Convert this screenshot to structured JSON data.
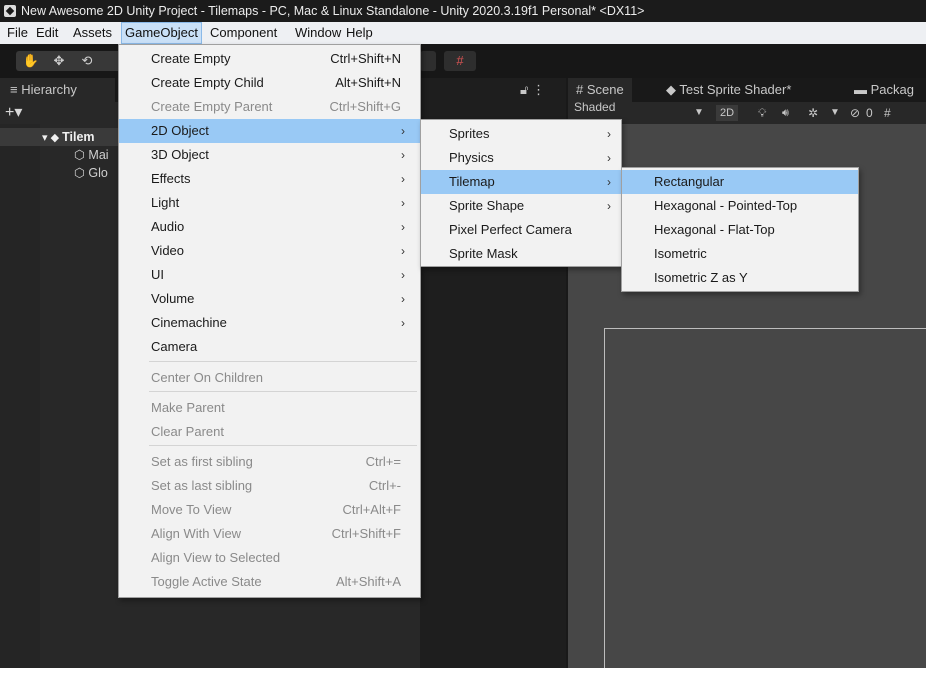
{
  "window": {
    "title": "New Awesome 2D Unity Project - Tilemaps - PC, Mac & Linux Standalone - Unity 2020.3.19f1 Personal* <DX11>"
  },
  "menubar": {
    "file": "File",
    "edit": "Edit",
    "assets": "Assets",
    "gameobject": "GameObject",
    "component": "Component",
    "window": "Window",
    "help": "Help"
  },
  "toolbar": {
    "hand_tool_icon": "hand-icon",
    "move_tool_icon": "move-icon",
    "rotate_tool_icon": "rotate-icon"
  },
  "hierarchy": {
    "tab_label": "Hierarchy",
    "add_label": "+▾",
    "root_item": "Tilem",
    "children": [
      "Mai",
      "Glo"
    ]
  },
  "scene": {
    "tabs": [
      "# Scene",
      "Test Sprite Shader*",
      "Packag"
    ],
    "shading_mode": "Shaded",
    "mode_2d": "2D",
    "hidden_count": "0"
  },
  "gameobject_menu": {
    "items": [
      {
        "label": "Create Empty",
        "shortcut": "Ctrl+Shift+N",
        "disabled": false,
        "submenu": false
      },
      {
        "label": "Create Empty Child",
        "shortcut": "Alt+Shift+N",
        "disabled": false,
        "submenu": false
      },
      {
        "label": "Create Empty Parent",
        "shortcut": "Ctrl+Shift+G",
        "disabled": true,
        "submenu": false
      },
      {
        "label": "2D Object",
        "shortcut": "",
        "disabled": false,
        "submenu": true,
        "highlighted": true
      },
      {
        "label": "3D Object",
        "shortcut": "",
        "disabled": false,
        "submenu": true
      },
      {
        "label": "Effects",
        "shortcut": "",
        "disabled": false,
        "submenu": true
      },
      {
        "label": "Light",
        "shortcut": "",
        "disabled": false,
        "submenu": true
      },
      {
        "label": "Audio",
        "shortcut": "",
        "disabled": false,
        "submenu": true
      },
      {
        "label": "Video",
        "shortcut": "",
        "disabled": false,
        "submenu": true
      },
      {
        "label": "UI",
        "shortcut": "",
        "disabled": false,
        "submenu": true
      },
      {
        "label": "Volume",
        "shortcut": "",
        "disabled": false,
        "submenu": true
      },
      {
        "label": "Cinemachine",
        "shortcut": "",
        "disabled": false,
        "submenu": true
      },
      {
        "label": "Camera",
        "shortcut": "",
        "disabled": false,
        "submenu": false
      },
      {
        "label": "Center On Children",
        "shortcut": "",
        "disabled": true,
        "submenu": false
      },
      {
        "label": "Make Parent",
        "shortcut": "",
        "disabled": true,
        "submenu": false
      },
      {
        "label": "Clear Parent",
        "shortcut": "",
        "disabled": true,
        "submenu": false
      },
      {
        "label": "Set as first sibling",
        "shortcut": "Ctrl+=",
        "disabled": true,
        "submenu": false
      },
      {
        "label": "Set as last sibling",
        "shortcut": "Ctrl+-",
        "disabled": true,
        "submenu": false
      },
      {
        "label": "Move To View",
        "shortcut": "Ctrl+Alt+F",
        "disabled": true,
        "submenu": false
      },
      {
        "label": "Align With View",
        "shortcut": "Ctrl+Shift+F",
        "disabled": true,
        "submenu": false
      },
      {
        "label": "Align View to Selected",
        "shortcut": "",
        "disabled": true,
        "submenu": false
      },
      {
        "label": "Toggle Active State",
        "shortcut": "Alt+Shift+A",
        "disabled": true,
        "submenu": false
      }
    ]
  },
  "object2d_menu": {
    "items": [
      {
        "label": "Sprites",
        "submenu": true
      },
      {
        "label": "Physics",
        "submenu": true
      },
      {
        "label": "Tilemap",
        "submenu": true,
        "highlighted": true
      },
      {
        "label": "Sprite Shape",
        "submenu": true
      },
      {
        "label": "Pixel Perfect Camera",
        "submenu": false
      },
      {
        "label": "Sprite Mask",
        "submenu": false
      }
    ]
  },
  "tilemap_menu": {
    "items": [
      {
        "label": "Rectangular",
        "highlighted": true
      },
      {
        "label": "Hexagonal - Pointed-Top"
      },
      {
        "label": "Hexagonal - Flat-Top"
      },
      {
        "label": "Isometric"
      },
      {
        "label": "Isometric Z as Y"
      }
    ]
  },
  "colors": {
    "menu_highlight": "#99c9f5",
    "editor_dark": "#282828"
  }
}
